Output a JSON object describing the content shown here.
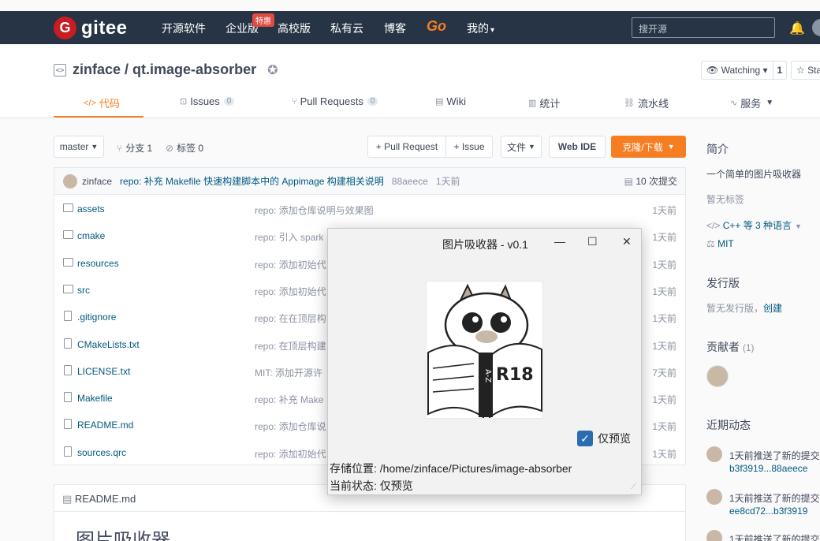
{
  "nav": {
    "logo_mark": "G",
    "logo_text": "gitee",
    "items": [
      "开源软件",
      "企业版",
      "高校版",
      "私有云",
      "博客",
      "Go",
      "我的"
    ],
    "badge": "特惠",
    "search_placeholder": "搜开源",
    "dropdown_caret": "▾"
  },
  "repo": {
    "owner": "zinface",
    "separator": " / ",
    "name": "qt.image-absorber",
    "watch_label": "Watching",
    "watch_count": "1",
    "star_label": "Sta"
  },
  "tabs": [
    {
      "label": "代码",
      "icon": "</>",
      "count": ""
    },
    {
      "label": "Issues",
      "icon": "⊡",
      "count": "0"
    },
    {
      "label": "Pull Requests",
      "icon": "⑂",
      "count": "0"
    },
    {
      "label": "Wiki",
      "icon": "▤",
      "count": ""
    },
    {
      "label": "统计",
      "icon": "▥",
      "count": ""
    },
    {
      "label": "流水线",
      "icon": "⛓",
      "count": ""
    },
    {
      "label": "服务",
      "icon": "∿",
      "count": ""
    }
  ],
  "toolbar": {
    "branch": "master",
    "branches": "分支 1",
    "tags": "标签 0",
    "pull_request": "+ Pull Request",
    "issue": "+ Issue",
    "file": "文件",
    "web_ide": "Web IDE",
    "clone": "克隆/下载"
  },
  "commit": {
    "author": "zinface",
    "message": "repo: 补充 Makefile 快速构建脚本中的 Appimage 构建相关说明",
    "sha": "88aeece",
    "time": "1天前",
    "count": "10 次提交"
  },
  "files": [
    {
      "name": "assets",
      "type": "dir",
      "message": "repo: 添加仓库说明与效果图",
      "time": "1天前"
    },
    {
      "name": "cmake",
      "type": "dir",
      "message": "repo: 引入 spark",
      "time": "1天前"
    },
    {
      "name": "resources",
      "type": "dir",
      "message": "repo: 添加初始代",
      "time": "1天前"
    },
    {
      "name": "src",
      "type": "dir",
      "message": "repo: 添加初始代",
      "time": "1天前"
    },
    {
      "name": ".gitignore",
      "type": "file",
      "message": "repo: 在在顶层构",
      "time": "1天前"
    },
    {
      "name": "CMakeLists.txt",
      "type": "file",
      "message": "repo: 在顶层构建",
      "time": "1天前"
    },
    {
      "name": "LICENSE.txt",
      "type": "file",
      "message": "MIT: 添加开源许",
      "time": "7天前"
    },
    {
      "name": "Makefile",
      "type": "file",
      "message": "repo: 补充 Make",
      "time": "1天前"
    },
    {
      "name": "README.md",
      "type": "file",
      "message": "repo: 添加仓库说",
      "time": "1天前"
    },
    {
      "name": "sources.qrc",
      "type": "file",
      "message": "repo: 添加初始代",
      "time": "1天前"
    }
  ],
  "readme": {
    "header": "README.md",
    "title": "图片吸收器"
  },
  "sidebar": {
    "intro_h": "简介",
    "intro": "一个简单的图片吸收器",
    "no_tags": "暂无标签",
    "lang": "C++ 等 3 种语言",
    "license": "MIT",
    "release_h": "发行版",
    "no_release": "暂无发行版，",
    "create": "创建",
    "contrib_h": "贡献者",
    "contrib_count": "(1)",
    "activity_h": "近期动态",
    "activities": [
      {
        "text": "1天前推送了新的提交",
        "range": "b3f3919...88aeece"
      },
      {
        "text": "1天前推送了新的提交",
        "range": "ee8cd72...b3f3919"
      },
      {
        "text": "1天前推送了新的提交",
        "range": ""
      }
    ]
  },
  "dialog": {
    "title": "图片吸收器 - v0.1",
    "minimize": "—",
    "maximize": "☐",
    "close": "✕",
    "preview_only": "仅预览",
    "storage": "存储位置: /home/zinface/Pictures/image-absorber",
    "status": "当前状态: 仅预览",
    "image_text": "R18",
    "book_spine": "A-Z"
  }
}
